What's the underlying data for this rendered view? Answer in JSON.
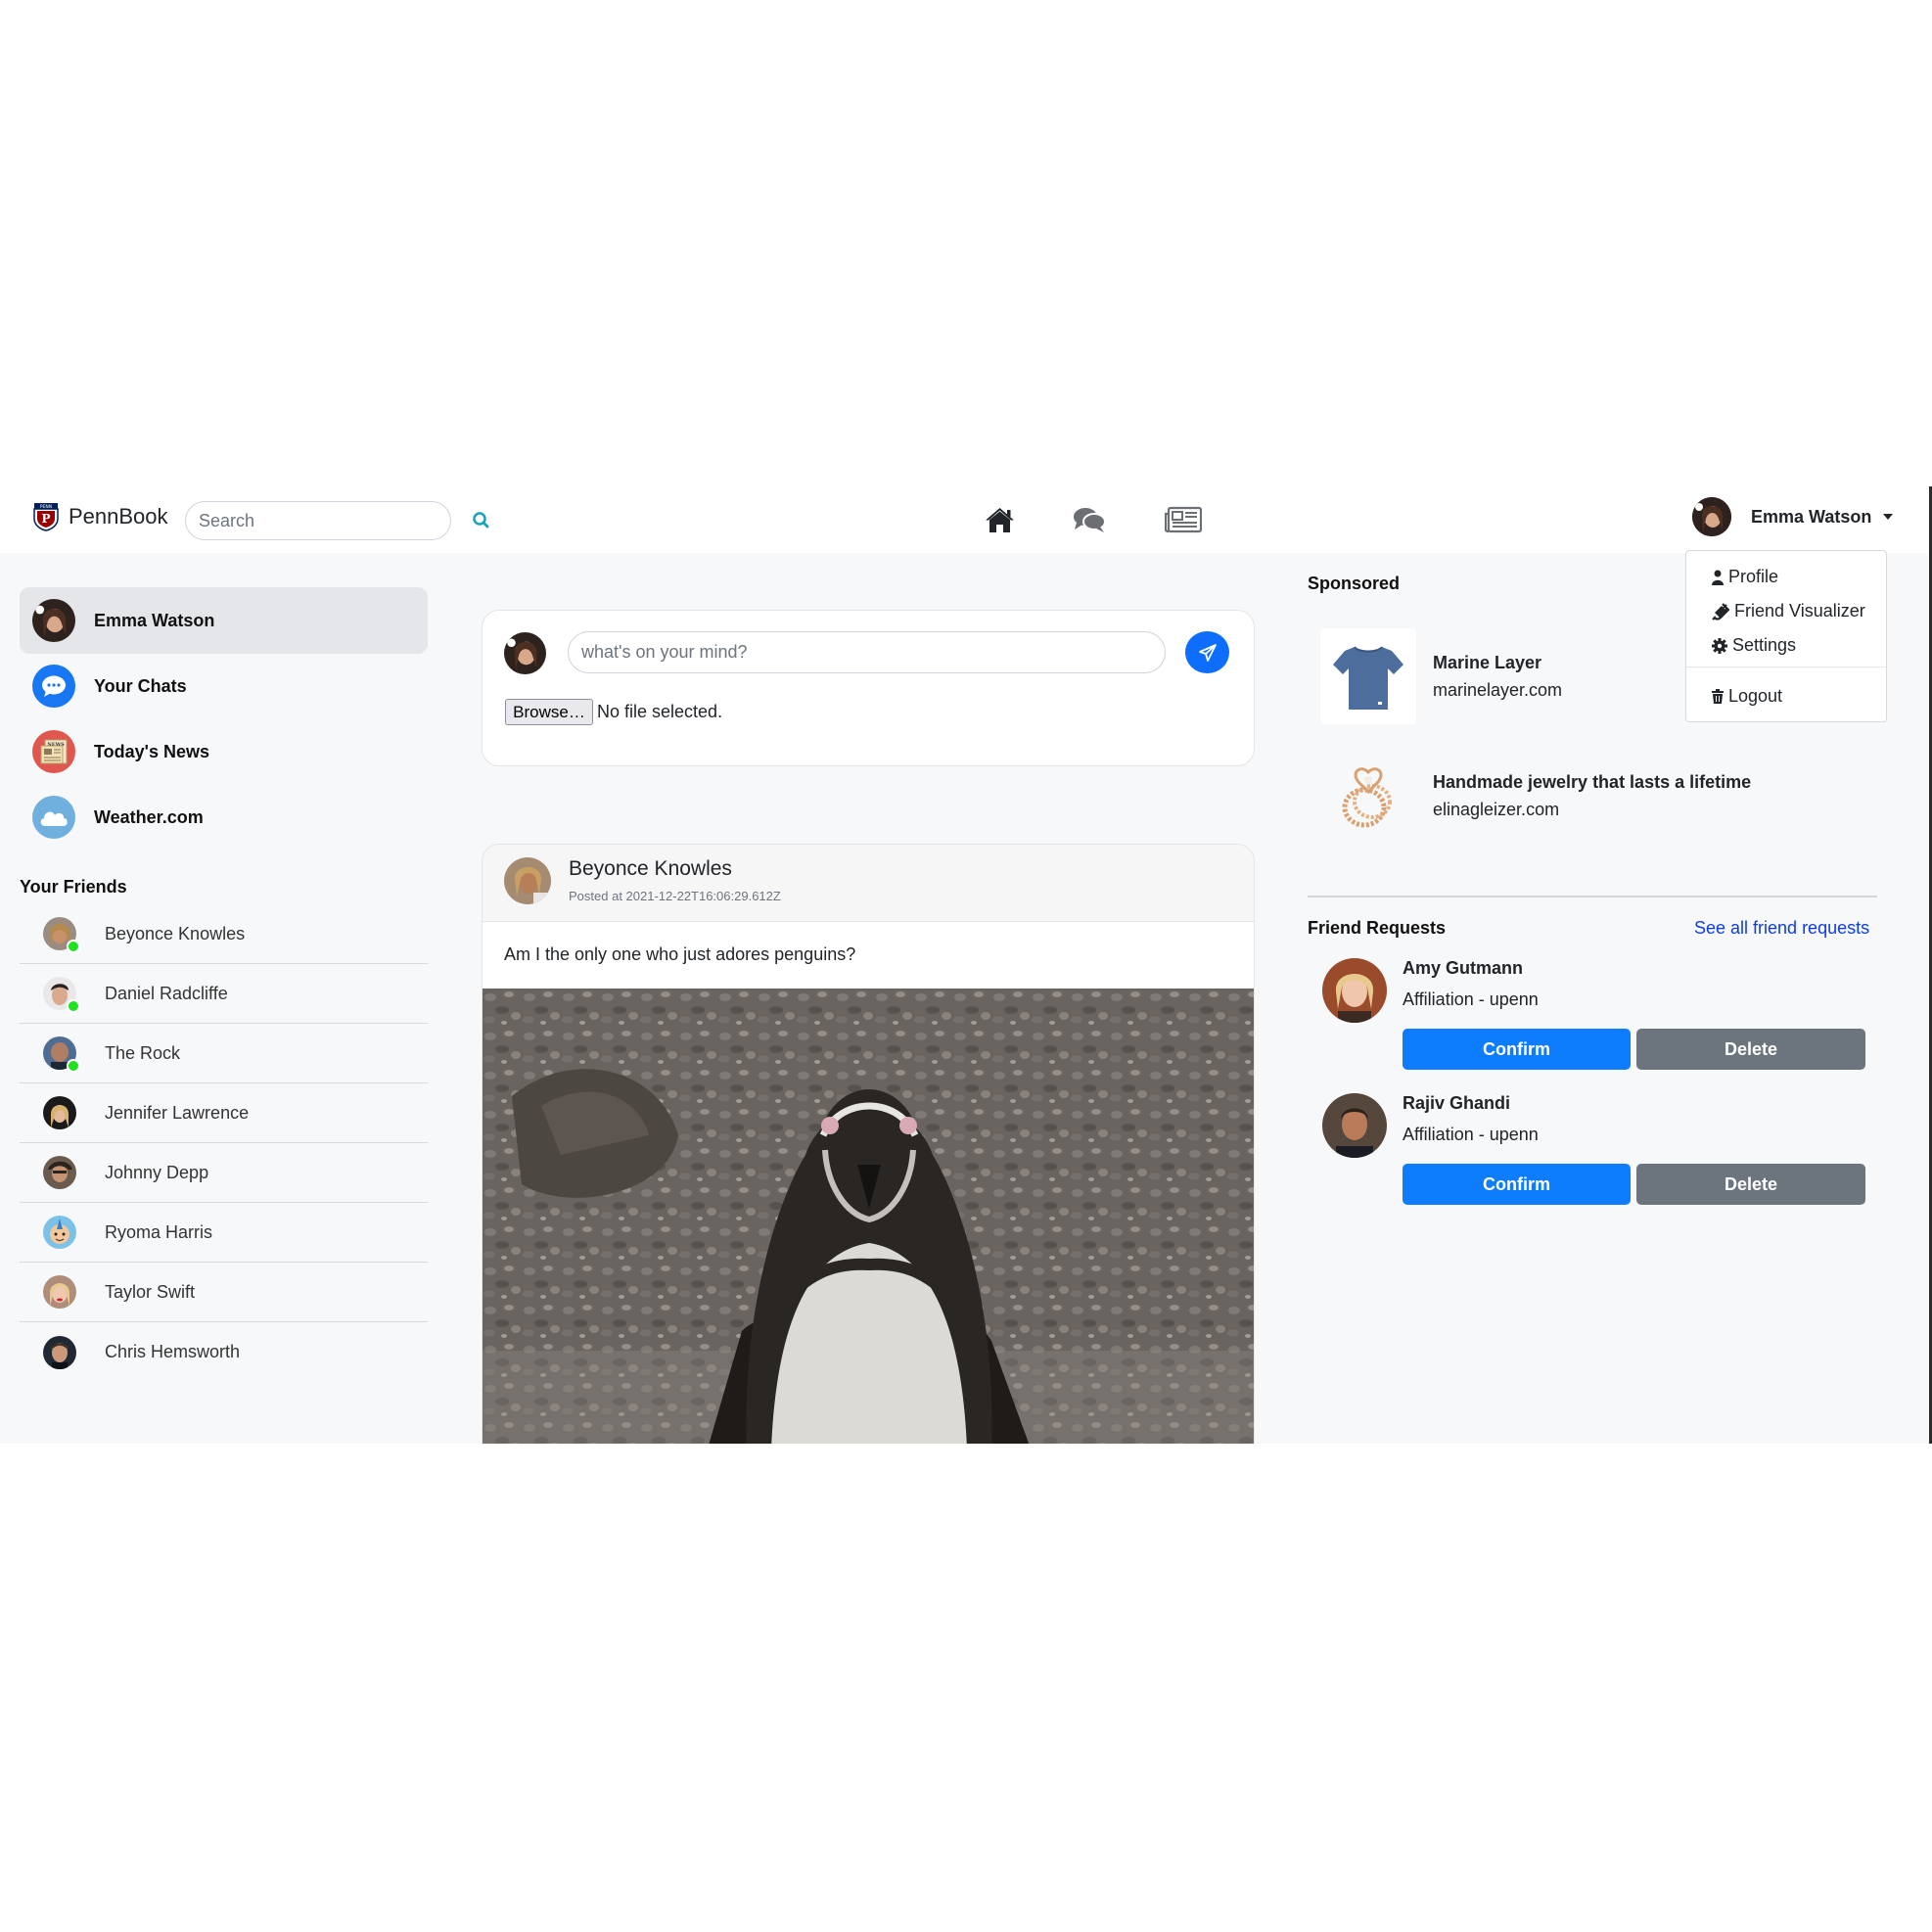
{
  "navbar": {
    "brand_name": "PennBook",
    "search_placeholder": "Search",
    "user_name": "Emma Watson",
    "icons": [
      "home-icon",
      "chats-icon",
      "news-icon"
    ]
  },
  "dropdown": {
    "items": [
      {
        "label": "Profile",
        "icon": "user-icon"
      },
      {
        "label": "Friend Visualizer",
        "icon": "plug-icon"
      },
      {
        "label": "Settings",
        "icon": "gear-icon"
      },
      {
        "label": "Logout",
        "icon": "trash-icon"
      }
    ]
  },
  "sidebar": {
    "items": [
      {
        "label": "Emma Watson",
        "icon": "avatar"
      },
      {
        "label": "Your Chats",
        "icon": "messenger-icon"
      },
      {
        "label": "Today's News",
        "icon": "news-icon"
      },
      {
        "label": "Weather.com",
        "icon": "cloud-icon"
      }
    ],
    "friends_title": "Your Friends",
    "friends": [
      {
        "name": "Beyonce Knowles",
        "online": true
      },
      {
        "name": "Daniel Radcliffe",
        "online": true
      },
      {
        "name": "The Rock",
        "online": true
      },
      {
        "name": "Jennifer Lawrence",
        "online": false
      },
      {
        "name": "Johnny Depp",
        "online": false
      },
      {
        "name": "Ryoma Harris",
        "online": false
      },
      {
        "name": "Taylor Swift",
        "online": false
      },
      {
        "name": "Chris Hemsworth",
        "online": false
      }
    ]
  },
  "composer": {
    "placeholder": "what's on your mind?",
    "browse_label": "Browse…",
    "file_status": "No file selected."
  },
  "post": {
    "author": "Beyonce Knowles",
    "time": "Posted at 2021-12-22T16:06:29.612Z",
    "text": "Am I the only one who just adores penguins?"
  },
  "sponsored": {
    "title": "Sponsored",
    "ads": [
      {
        "title": "Marine Layer",
        "url": "marinelayer.com"
      },
      {
        "title": "Handmade jewelry that lasts a lifetime",
        "url": "elinagleizer.com"
      }
    ]
  },
  "friend_requests": {
    "title": "Friend Requests",
    "see_all": "See all friend requests",
    "confirm_label": "Confirm",
    "delete_label": "Delete",
    "requests": [
      {
        "name": "Amy Gutmann",
        "affiliation": "Affiliation - upenn"
      },
      {
        "name": "Rajiv Ghandi",
        "affiliation": "Affiliation - upenn"
      }
    ]
  },
  "colors": {
    "primary": "#0d7dfd",
    "secondary": "#6c757d",
    "online": "#1fe21f",
    "link": "#0d3ce6",
    "background": "#f7f8fa"
  }
}
